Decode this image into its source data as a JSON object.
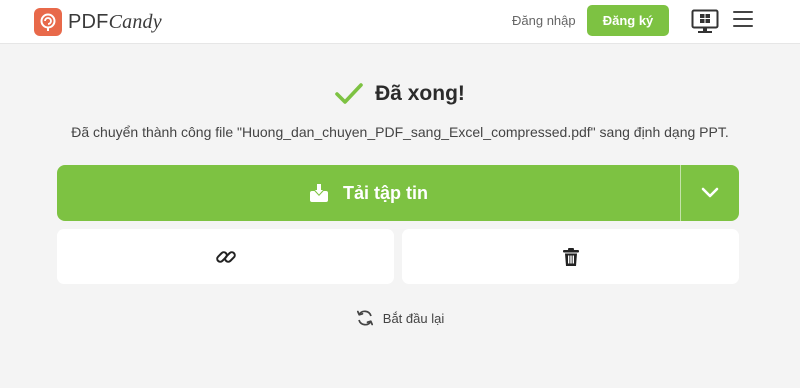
{
  "header": {
    "logo": {
      "part1": "PDF",
      "part2": "Candy"
    },
    "login_label": "Đăng nhập",
    "signup_label": "Đăng ký",
    "icons": [
      "desktop-app-icon",
      "hamburger-menu-icon"
    ]
  },
  "result": {
    "title": "Đã xong!",
    "message": "Đã chuyển thành công file \"Huong_dan_chuyen_PDF_sang_Excel_compressed.pdf\" sang định dạng PPT."
  },
  "download": {
    "label": "Tải tập tin",
    "icons": [
      "download-icon",
      "chevron-down-icon"
    ]
  },
  "actions": {
    "icons": [
      "link-icon",
      "trash-icon"
    ]
  },
  "restart": {
    "label": "Bắt đầu lại",
    "icon": "refresh-icon"
  },
  "colors": {
    "accent": "#7dc242",
    "brand": "#e8694a",
    "background": "#f4f4f4"
  }
}
